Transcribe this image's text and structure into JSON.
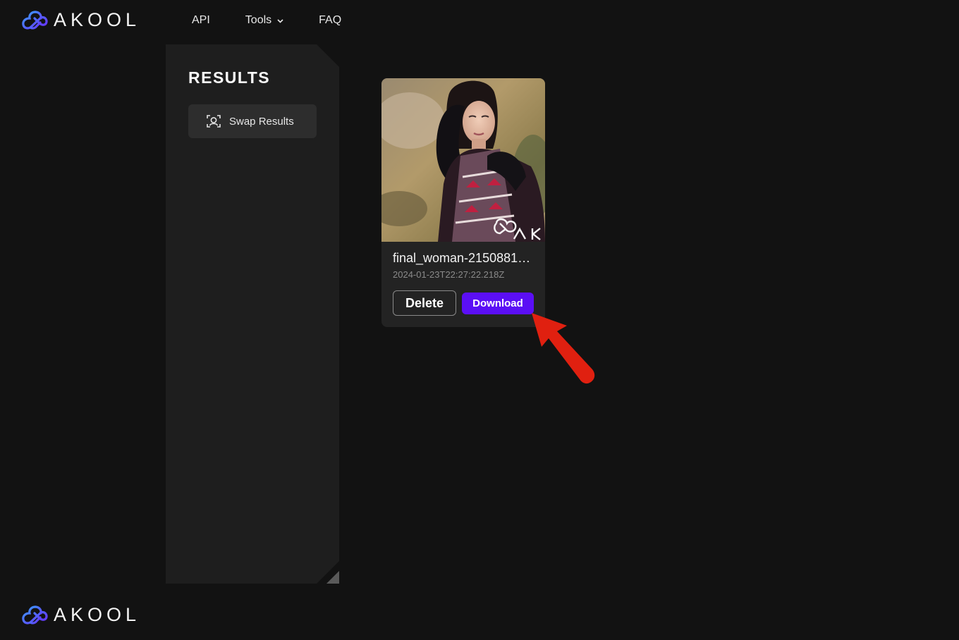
{
  "brand": {
    "name": "AKOOL",
    "accent": "#5b0ff5",
    "logo_icon": "akool-cloud-logo-icon"
  },
  "nav": {
    "items": [
      {
        "label": "API"
      },
      {
        "label": "Tools",
        "icon": "chevron-down-icon"
      },
      {
        "label": "FAQ"
      }
    ]
  },
  "sidebar": {
    "title": "RESULTS",
    "button": {
      "label": "Swap Results",
      "icon": "face-scan-icon"
    }
  },
  "result_card": {
    "filename": "final_woman-2150881…",
    "timestamp": "2024-01-23T22:27:22.218Z",
    "delete_label": "Delete",
    "download_label": "Download"
  },
  "colors": {
    "background": "#121212",
    "panel": "#1e1e1e",
    "card": "#232323",
    "annotation_arrow": "#e02010"
  }
}
